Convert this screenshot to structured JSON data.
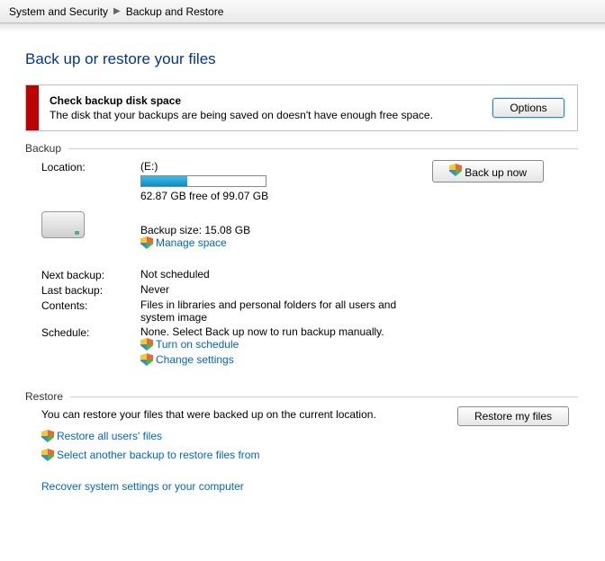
{
  "breadcrumb": {
    "item1": "System and Security",
    "item2": "Backup and Restore"
  },
  "title": "Back up or restore your files",
  "alert": {
    "title": "Check backup disk space",
    "message": "The disk that your backups are being saved on doesn't have enough free space.",
    "button": "Options"
  },
  "sections": {
    "backup": "Backup",
    "restore": "Restore"
  },
  "backup": {
    "backup_now_btn": "Back up now",
    "location_label": "Location:",
    "location_value": "(E:)",
    "free_space": "62.87 GB free of 99.07 GB",
    "progress_percent": 37,
    "backup_size": "Backup size: 15.08 GB",
    "manage_space": "Manage space",
    "next_label": "Next backup:",
    "next_value": "Not scheduled",
    "last_label": "Last backup:",
    "last_value": "Never",
    "contents_label": "Contents:",
    "contents_value": "Files in libraries and personal folders for all users and system image",
    "schedule_label": "Schedule:",
    "schedule_value": "None. Select Back up now to run backup manually.",
    "turn_on": "Turn on schedule",
    "change_settings": "Change settings"
  },
  "restore": {
    "intro": "You can restore your files that were backed up on the current location.",
    "restore_btn": "Restore my files",
    "restore_all": "Restore all users' files",
    "select_another": "Select another backup to restore files from",
    "recover": "Recover system settings or your computer"
  }
}
